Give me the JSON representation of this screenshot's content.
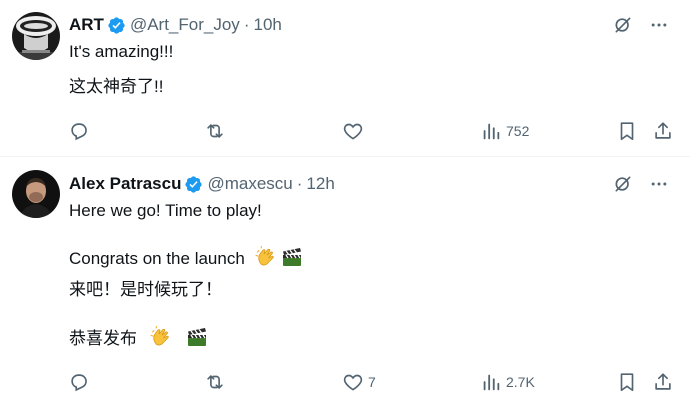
{
  "tweets": [
    {
      "display_name": "ART",
      "handle": "@Art_For_Joy",
      "separator": "·",
      "time": "10h",
      "lines": [
        "It's amazing!!!",
        "这太神奇了!!"
      ],
      "actions": {
        "replies": "",
        "reposts": "",
        "likes": "",
        "views": "752"
      }
    },
    {
      "display_name": "Alex Patrascu",
      "handle": "@maxescu",
      "separator": "·",
      "time": "12h",
      "lines": [
        "Here we go! Time to play!",
        "Congrats on the launch",
        "来吧！是时候玩了！",
        "恭喜发布"
      ],
      "actions": {
        "replies": "",
        "reposts": "",
        "likes": "7",
        "views": "2.7K"
      }
    }
  ],
  "icons": {
    "verified": "verified-badge-icon",
    "grok": "grok-slash-icon",
    "more": "more-dots-icon",
    "reply": "reply-icon",
    "repost": "repost-icon",
    "like": "heart-icon",
    "views": "views-bar-icon",
    "bookmark": "bookmark-icon",
    "share": "share-icon",
    "clap": "clapping-hands-emoji",
    "clapper": "clapper-board-emoji"
  },
  "colors": {
    "text": "#0f1419",
    "secondary": "#536471",
    "verified": "#1d9bf0",
    "divider": "#eff3f4"
  }
}
